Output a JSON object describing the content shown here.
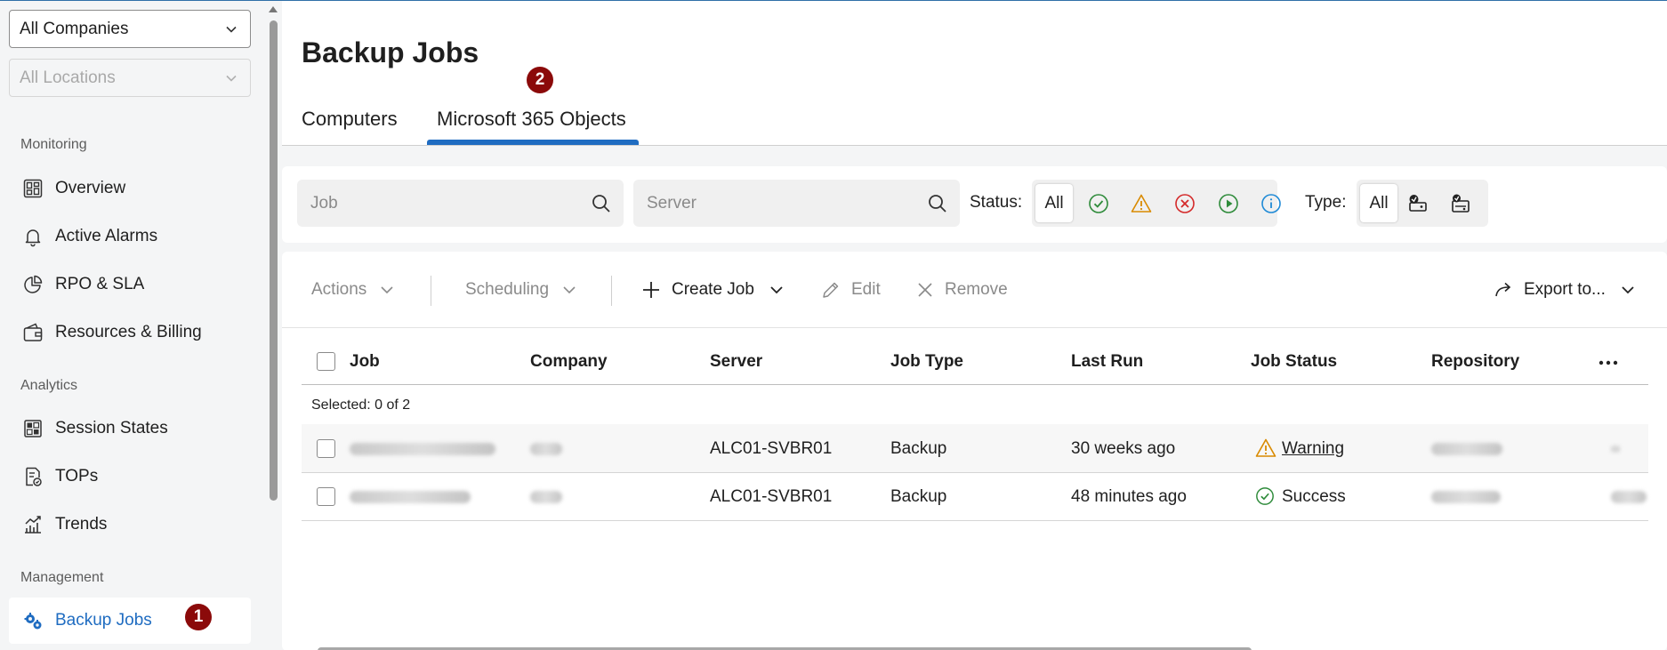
{
  "sidebar": {
    "company_select": "All Companies",
    "location_select": "All Locations",
    "sections": {
      "monitoring": "Monitoring",
      "analytics": "Analytics",
      "management": "Management"
    },
    "items": {
      "overview": "Overview",
      "active_alarms": "Active Alarms",
      "rpo_sla": "RPO & SLA",
      "resources_billing": "Resources & Billing",
      "session_states": "Session States",
      "tops": "TOPs",
      "trends": "Trends",
      "backup_jobs": "Backup Jobs"
    },
    "badge": "1"
  },
  "header": {
    "title": "Backup Jobs",
    "tabs": [
      "Computers",
      "Microsoft 365 Objects"
    ],
    "active_tab": "Microsoft 365 Objects",
    "badge": "2"
  },
  "filters": {
    "job_placeholder": "Job",
    "server_placeholder": "Server",
    "status_label": "Status:",
    "status_all": "All",
    "status_icons": [
      "success-icon",
      "warning-icon",
      "error-icon",
      "running-icon",
      "info-icon"
    ],
    "type_label": "Type:",
    "type_all": "All",
    "type_icons": [
      "backup-type-icon",
      "copy-type-icon"
    ]
  },
  "toolbar": {
    "actions": "Actions",
    "scheduling": "Scheduling",
    "create_job": "Create Job",
    "edit": "Edit",
    "remove": "Remove",
    "export": "Export to..."
  },
  "table": {
    "columns": [
      "Job",
      "Company",
      "Server",
      "Job Type",
      "Last Run",
      "Job Status",
      "Repository"
    ],
    "selected_text": "Selected: 0 of 2",
    "rows": [
      {
        "server": "ALC01-SVBR01",
        "job_type": "Backup",
        "last_run": "30 weeks ago",
        "status": "Warning"
      },
      {
        "server": "ALC01-SVBR01",
        "job_type": "Backup",
        "last_run": "48 minutes ago",
        "status": "Success"
      }
    ]
  },
  "colors": {
    "accent": "#1f6cc1",
    "badge": "#8b0a0a",
    "success": "#2e8b3a",
    "warning": "#d98a00",
    "error": "#d42a2a",
    "info": "#1f8ad6"
  }
}
